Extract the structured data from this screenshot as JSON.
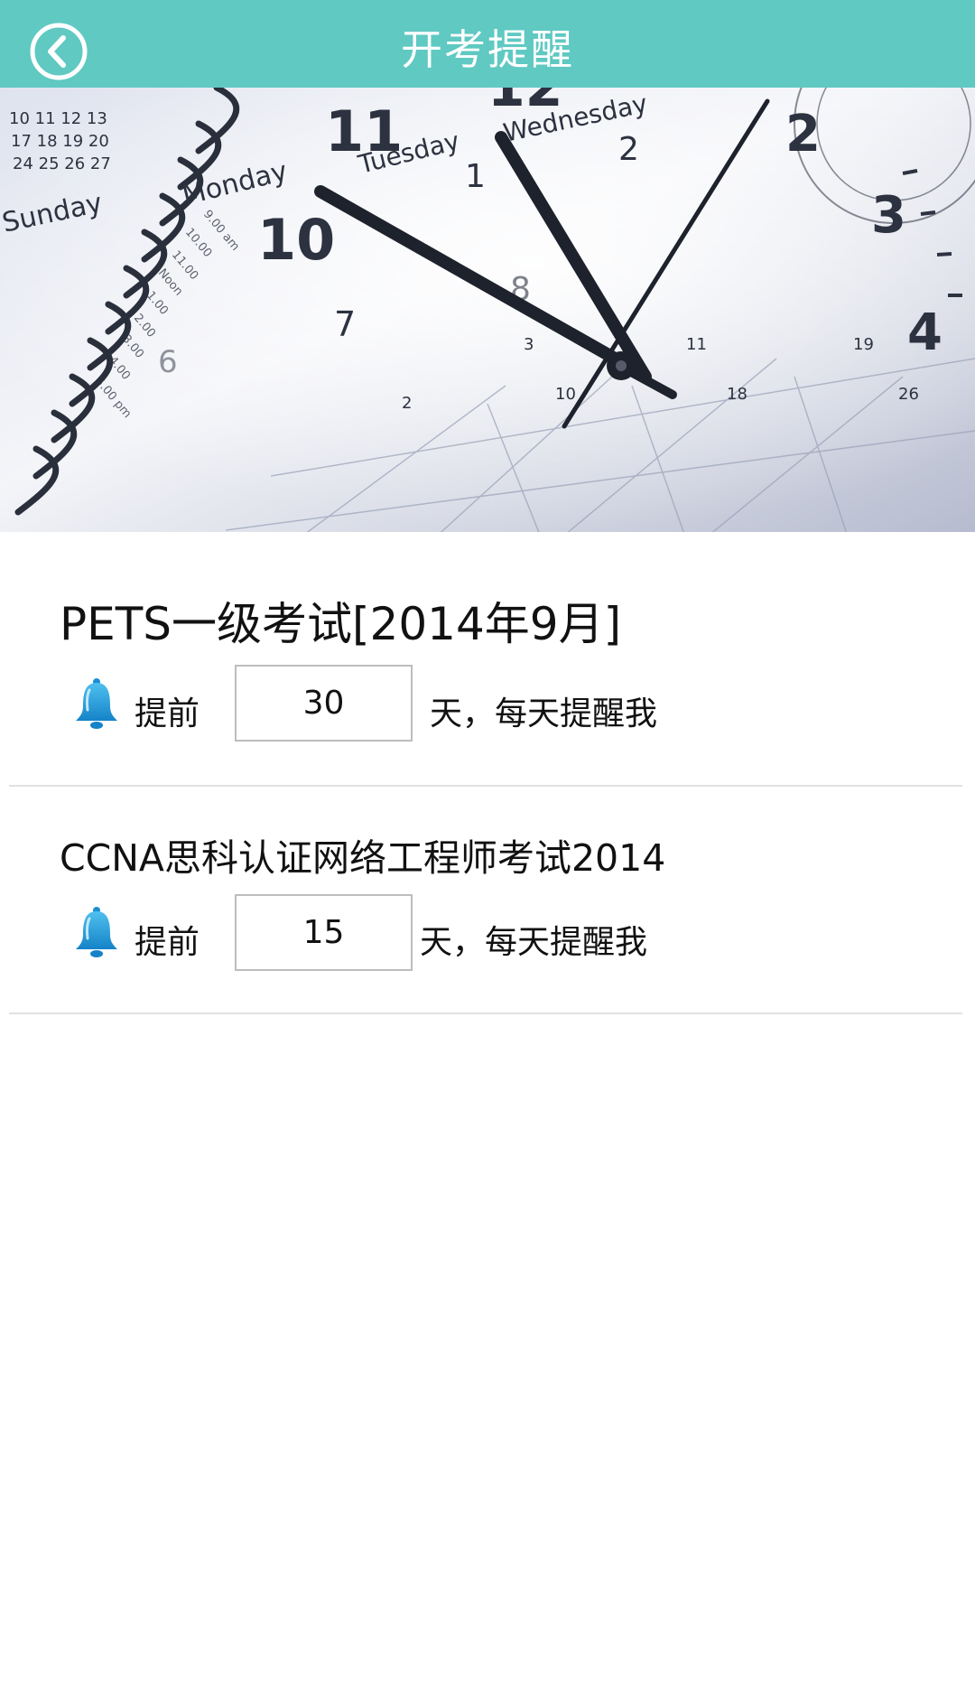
{
  "header": {
    "title": "开考提醒",
    "back_icon": "chevron-left-circle-icon",
    "color": "#5fc9c2"
  },
  "banner": {
    "description_icon": "clock-calendar-banner"
  },
  "reminders": [
    {
      "exam_name": "PETS一级考试[2014年9月]",
      "prefix": "提前",
      "days": "30",
      "suffix": "天，每天提醒我"
    },
    {
      "exam_name": "CCNA思科认证网络工程师考试2014",
      "prefix": "提前",
      "days": "15",
      "suffix": "天，每天提醒我"
    }
  ]
}
